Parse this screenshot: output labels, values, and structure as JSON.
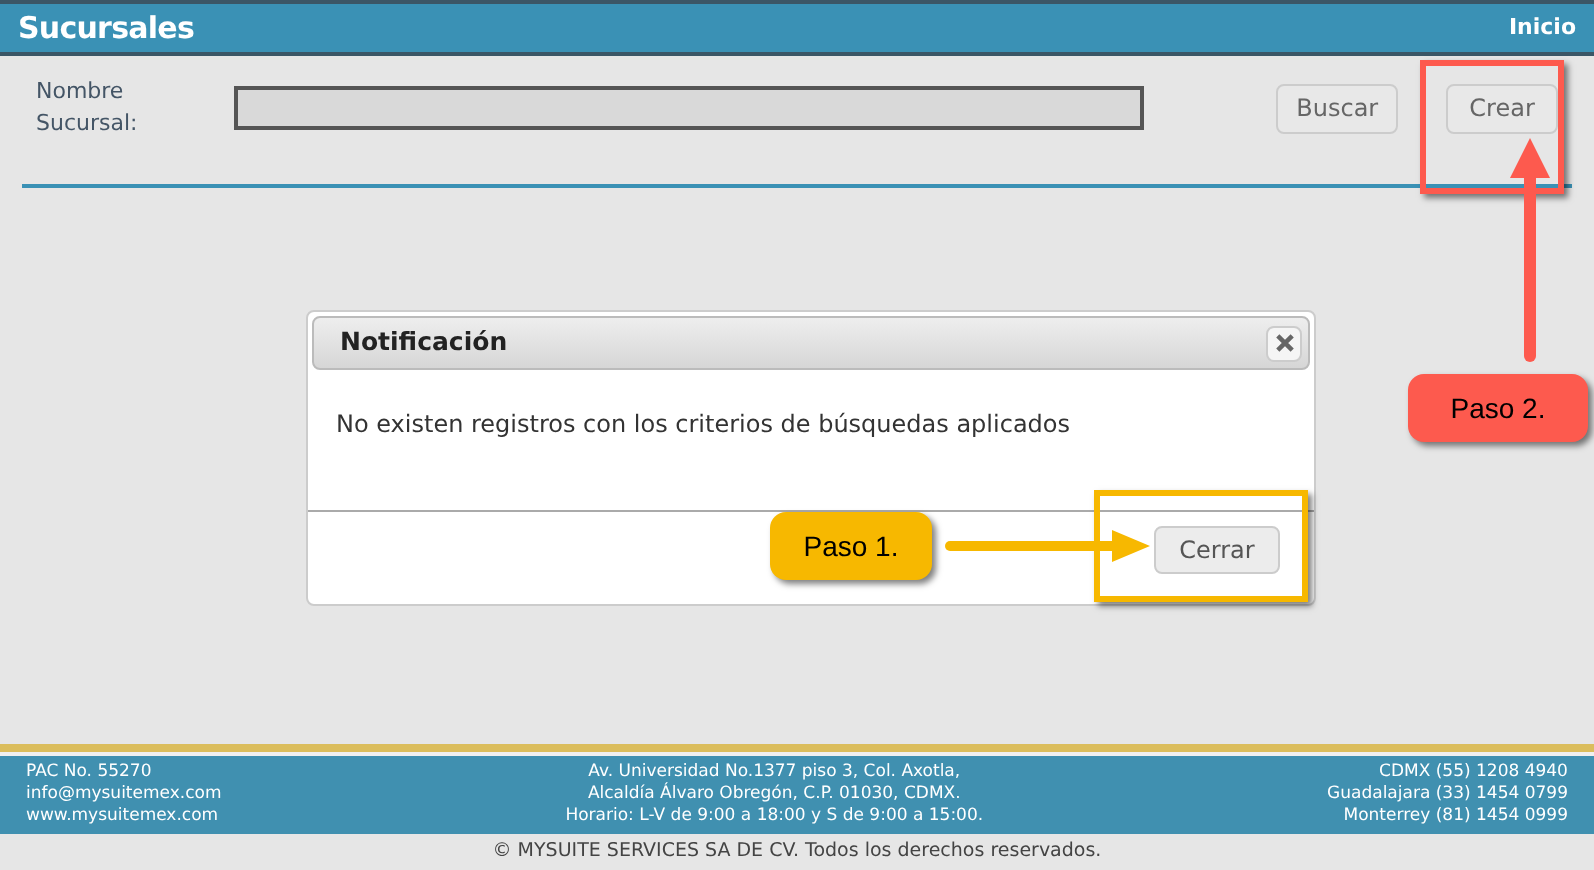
{
  "header": {
    "title": "Sucursales",
    "nav_link": "Inicio"
  },
  "search": {
    "label": "Nombre Sucursal:",
    "buttons": [
      "Buscar",
      "Crear"
    ]
  },
  "dialog": {
    "title": "Notificación",
    "message": "No existen registros con los criterios de búsquedas aplicados",
    "button": "Cerrar"
  },
  "callouts": [
    {
      "label": "Paso 1.",
      "color": "#f7b800"
    },
    {
      "label": "Paso 2.",
      "color": "#fd5a4e"
    }
  ],
  "footer": {
    "left": [
      "PAC No. 55270",
      "info@mysuitemex.com",
      "www.mysuitemex.com"
    ],
    "center": [
      "Av. Universidad No.1377 piso 3, Col. Axotla,",
      "Alcaldía Álvaro Obregón, C.P. 01030, CDMX.",
      "Horario: L-V de 9:00 a 18:00 y S de 9:00 a 15:00."
    ],
    "right": [
      "CDMX (55) 1208 4940",
      "Guadalajara (33) 1454 0799",
      "Monterrey (81) 1454 0999"
    ],
    "copyright": "© MYSUITE SERVICES SA DE CV. Todos los derechos reservados."
  }
}
